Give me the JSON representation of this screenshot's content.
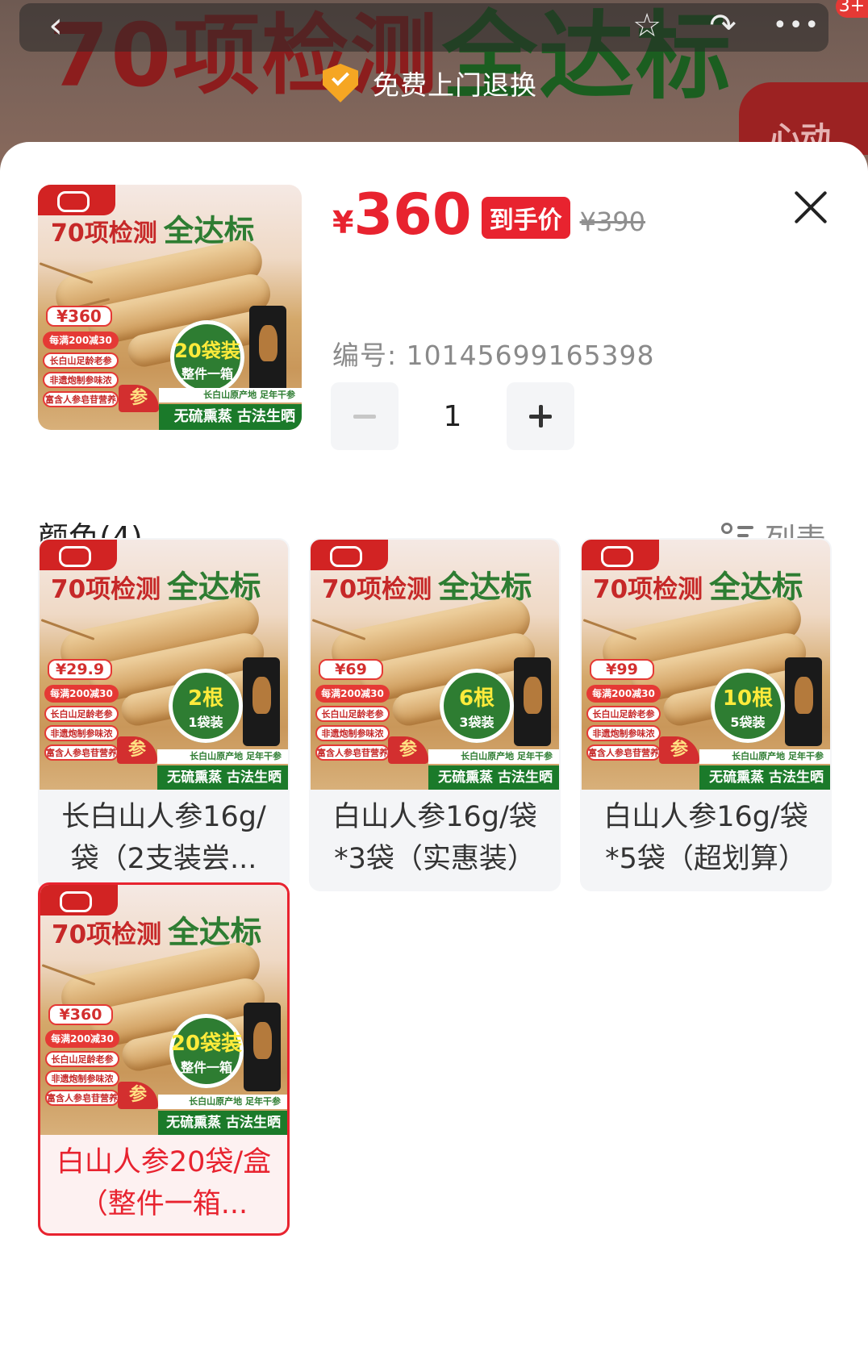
{
  "backdrop": {
    "headline_red": "70项检测",
    "headline_green": "全达标",
    "corner_text": "心动",
    "banner_text": "免费上门退换",
    "cart_badge": "3+"
  },
  "product": {
    "price_symbol": "¥",
    "price": "360",
    "price_tag": "到手价",
    "original_price": "¥390",
    "sku_label": "编号: 10145699165398",
    "quantity": "1"
  },
  "options_section": {
    "title": "颜色(4)",
    "view_toggle": "列表"
  },
  "thumbnail_text": {
    "headline_red": "70项检测",
    "headline_green": "全达标",
    "pill_1": "每满200减30",
    "pill_2": "长白山足龄老参",
    "pill_3": "非遗炮制参味浓",
    "pill_4": "富含人参皂苷营养",
    "ginseng_tag": "参",
    "footer_top": "长白山原产地  足年干参",
    "footer": "无硫熏蒸 古法生晒"
  },
  "main_thumbnail": {
    "price": "360",
    "badge_line1": "20袋装",
    "badge_line2": "整件一箱"
  },
  "options": [
    {
      "label": "长白山人参16g/袋（2支装尝...",
      "price": "29.9",
      "badge_line1": "2根",
      "badge_line2": "1袋装",
      "selected": false
    },
    {
      "label": "白山人参16g/袋*3袋（实惠装）",
      "price": "69",
      "badge_line1": "6根",
      "badge_line2": "3袋装",
      "selected": false
    },
    {
      "label": "白山人参16g/袋*5袋（超划算）",
      "price": "99",
      "badge_line1": "10根",
      "badge_line2": "5袋装",
      "selected": false
    },
    {
      "label": "白山人参20袋/盒（整件一箱...",
      "price": "360",
      "badge_line1": "20袋装",
      "badge_line2": "整件一箱",
      "selected": true
    }
  ],
  "colors": {
    "accent_red": "#e8232f",
    "badge_green": "#2e7d32",
    "shield_orange": "#f5a623"
  },
  "icons": [
    "back-arrow-icon",
    "star-icon",
    "share-icon",
    "more-icon",
    "shield-check-icon",
    "close-icon",
    "minus-icon",
    "plus-icon",
    "list-view-icon"
  ]
}
